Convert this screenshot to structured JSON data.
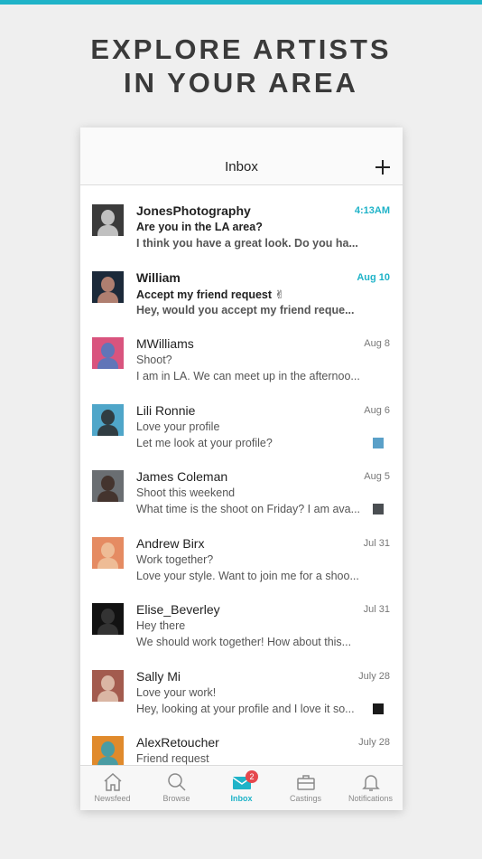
{
  "headline": {
    "line1": "EXPLORE ARTISTS",
    "line2": "IN YOUR AREA"
  },
  "colors": {
    "accent": "#1fb3c8",
    "badge": "#e5484d",
    "banner": "#1fb3c8"
  },
  "inbox": {
    "title": "Inbox",
    "compose_icon": "plus-icon",
    "messages": [
      {
        "sender": "JonesPhotography",
        "subject": "Are you in the LA area?",
        "preview": "I think you have a great look. Do you ha...",
        "date": "4:13AM",
        "unread": true,
        "avatar_colors": [
          "#3b3b3b",
          "#d8d8d8"
        ],
        "attachment": false
      },
      {
        "sender": "William",
        "subject": "Accept my friend request ✌",
        "preview": "Hey, would you accept my friend reque...",
        "date": "Aug 10",
        "unread": true,
        "avatar_colors": [
          "#1c2a3a",
          "#c98e7a"
        ],
        "attachment": false
      },
      {
        "sender": "MWilliams",
        "subject": "Shoot?",
        "preview": "I am in LA. We can meet up in the afternoo...",
        "date": "Aug 8",
        "unread": false,
        "avatar_colors": [
          "#d9547e",
          "#4b7bc2"
        ],
        "attachment": false
      },
      {
        "sender": "Lili Ronnie",
        "subject": "Love your profile",
        "preview": "Let me look at your profile?",
        "date": "Aug 6",
        "unread": false,
        "avatar_colors": [
          "#4fa6c9",
          "#2a2a2a"
        ],
        "attachment": true,
        "attachment_color": "#5aa0c8"
      },
      {
        "sender": "James Coleman",
        "subject": "Shoot this weekend",
        "preview": "What time is the shoot on Friday? I am ava...",
        "date": "Aug 5",
        "unread": false,
        "avatar_colors": [
          "#6a6e72",
          "#3d2a22"
        ],
        "attachment": true,
        "attachment_color": "#4a4e52"
      },
      {
        "sender": "Andrew Birx",
        "subject": "Work together?",
        "preview": "Love your style. Want to join me for a shoo...",
        "date": "Jul 31",
        "unread": false,
        "avatar_colors": [
          "#e58b62",
          "#f0c4a0"
        ],
        "attachment": false
      },
      {
        "sender": "Elise_Beverley",
        "subject": "Hey there",
        "preview": "We should work together! How about this...",
        "date": "Jul 31",
        "unread": false,
        "avatar_colors": [
          "#121212",
          "#3a3a3a"
        ],
        "attachment": false
      },
      {
        "sender": "Sally Mi",
        "subject": "Love your work!",
        "preview": "Hey, looking at your profile and I love it so...",
        "date": "July 28",
        "unread": false,
        "avatar_colors": [
          "#a35b4e",
          "#e4c7b4"
        ],
        "attachment": true,
        "attachment_color": "#1a1a1a"
      },
      {
        "sender": "AlexRetoucher",
        "subject": "Friend request",
        "preview": "",
        "date": "July 28",
        "unread": false,
        "avatar_colors": [
          "#e08a2c",
          "#2f9fb8"
        ],
        "attachment": false
      }
    ]
  },
  "tabbar": {
    "tabs": [
      {
        "label": "Newsfeed",
        "icon": "home-icon",
        "active": false
      },
      {
        "label": "Browse",
        "icon": "search-icon",
        "active": false
      },
      {
        "label": "Inbox",
        "icon": "envelope-icon",
        "active": true
      },
      {
        "label": "Castings",
        "icon": "briefcase-icon",
        "active": false
      },
      {
        "label": "Notifications",
        "icon": "bell-icon",
        "active": false
      }
    ],
    "inbox_badge": "2"
  }
}
